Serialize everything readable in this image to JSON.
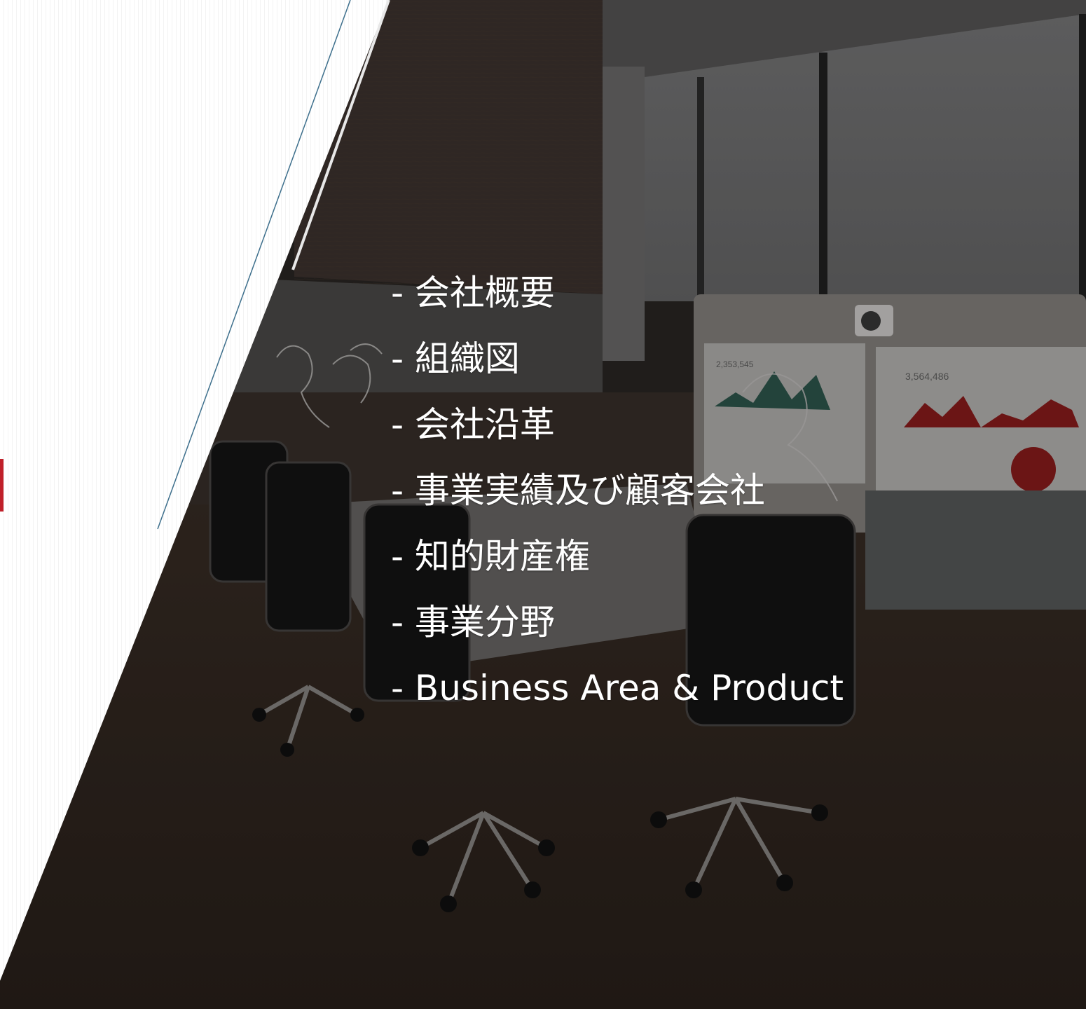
{
  "menu": {
    "items": [
      {
        "label": "- 会社概要"
      },
      {
        "label": "- 組織図"
      },
      {
        "label": "- 会社沿革"
      },
      {
        "label": "- 事業実績及び顧客会社"
      },
      {
        "label": "- 知的財産権"
      },
      {
        "label": "- 事業分野"
      },
      {
        "label": "- Business Area & Product"
      }
    ]
  },
  "screen": {
    "left_value": "2,353,545",
    "right_value": "3,564,486"
  },
  "colors": {
    "accent": "#c0202a",
    "line": "#3d6f8c",
    "overlay": "#2b2724",
    "text": "#ffffff"
  }
}
